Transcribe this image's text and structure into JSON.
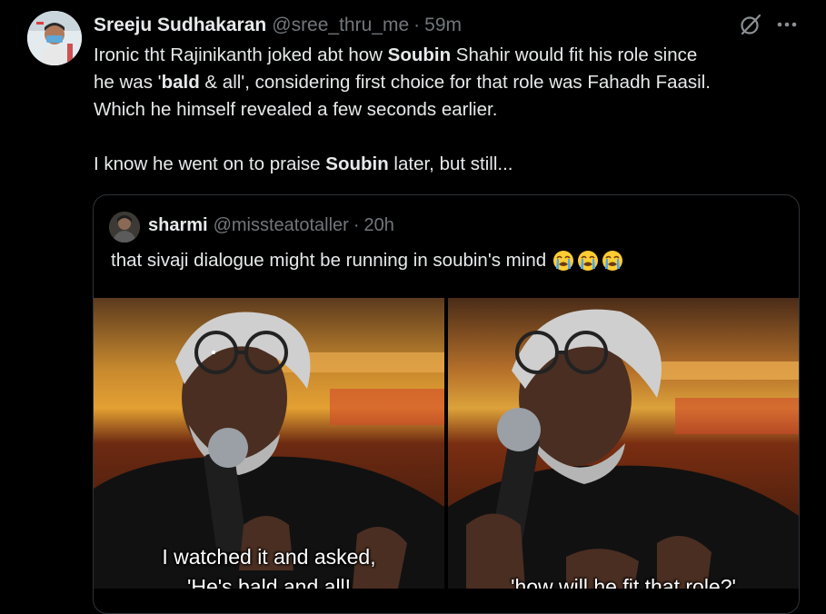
{
  "tweet": {
    "display_name": "Sreeju Sudhakaran",
    "handle": "@sree_thru_me",
    "time": "59m",
    "separator": "·",
    "paragraphs": [
      [
        {
          "t": "Ironic tht Rajinikanth joked abt how ",
          "b": false
        },
        {
          "t": "Soubin",
          "b": true
        },
        {
          "t": " Shahir would fit his role since",
          "b": false
        }
      ],
      [
        {
          "t": "he was '",
          "b": false
        },
        {
          "t": "bald",
          "b": true
        },
        {
          "t": " & all', considering first choice for that role was Fahadh Faasil.",
          "b": false
        }
      ],
      [
        {
          "t": "Which he himself revealed a few seconds earlier.",
          "b": false
        }
      ],
      [],
      [
        {
          "t": "I know he went on to praise ",
          "b": false
        },
        {
          "t": "Soubin",
          "b": true
        },
        {
          "t": " later, but still...",
          "b": false
        }
      ]
    ],
    "icons": {
      "grok": "grok-icon",
      "more": "more-icon",
      "avatar": "avatar"
    }
  },
  "quote": {
    "display_name": "sharmi",
    "handle": "@missteatotaller",
    "separator": "·",
    "time": "20h",
    "text": "that sivaji dialogue might be running in soubin's mind",
    "emoji": [
      "loudly-crying-face-icon",
      "loudly-crying-face-icon",
      "loudly-crying-face-icon"
    ],
    "media": {
      "left_caption_1": "I watched it and asked,",
      "left_caption_2": "'He's bald and all!",
      "right_caption": "'how will he fit that role?'"
    }
  },
  "colors": {
    "background": "#000000",
    "text": "#e7e9ea",
    "muted": "#71767b",
    "border": "#2f3336"
  }
}
